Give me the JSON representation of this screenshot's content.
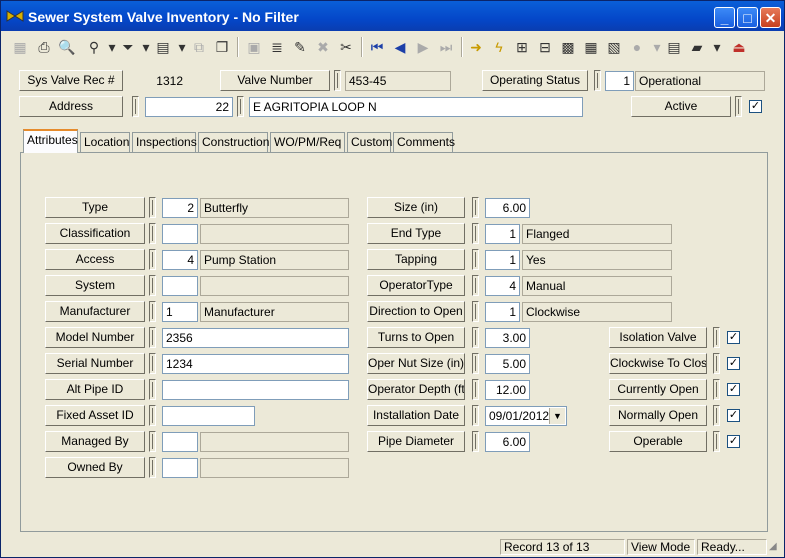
{
  "window": {
    "title": "Sewer System Valve Inventory - No Filter"
  },
  "header": {
    "rec_label": "Sys Valve Rec #",
    "rec_value": "1312",
    "valve_number_label": "Valve Number",
    "valve_number": "453-45",
    "operating_status_label": "Operating Status",
    "operating_status_code": "1",
    "operating_status": "Operational",
    "address_label": "Address",
    "address_number": "22",
    "address_street": "E AGRITOPIA LOOP N",
    "active_label": "Active",
    "active_checked": "✓"
  },
  "tabs": [
    "Attributes",
    "Location",
    "Inspections",
    "Construction",
    "WO/PM/Req",
    "Custom",
    "Comments"
  ],
  "left": {
    "type": {
      "label": "Type",
      "code": "2",
      "value": "Butterfly"
    },
    "classification": {
      "label": "Classification",
      "code": "",
      "value": ""
    },
    "access": {
      "label": "Access",
      "code": "4",
      "value": "Pump Station"
    },
    "system": {
      "label": "System",
      "code": "",
      "value": ""
    },
    "manufacturer": {
      "label": "Manufacturer",
      "code": "1",
      "value": "Manufacturer"
    },
    "model_number": {
      "label": "Model Number",
      "value": "2356"
    },
    "serial_number": {
      "label": "Serial Number",
      "value": "1234"
    },
    "alt_pipe_id": {
      "label": "Alt Pipe ID",
      "value": ""
    },
    "fixed_asset_id": {
      "label": "Fixed Asset ID",
      "value": ""
    },
    "managed_by": {
      "label": "Managed By",
      "code": "",
      "value": ""
    },
    "owned_by": {
      "label": "Owned By",
      "code": "",
      "value": ""
    }
  },
  "middle": {
    "size": {
      "label": "Size (in)",
      "value": "6.00"
    },
    "end_type": {
      "label": "End Type",
      "code": "1",
      "value": "Flanged"
    },
    "tapping": {
      "label": "Tapping",
      "code": "1",
      "value": "Yes"
    },
    "operator_type": {
      "label": "OperatorType",
      "code": "4",
      "value": "Manual"
    },
    "direction_to_open": {
      "label": "Direction to Open",
      "code": "1",
      "value": "Clockwise"
    },
    "turns_to_open": {
      "label": "Turns to Open",
      "value": "3.00"
    },
    "oper_nut_size": {
      "label": "Oper Nut Size (in)",
      "value": "5.00"
    },
    "operator_depth": {
      "label": "Operator Depth (ft)",
      "value": "12.00"
    },
    "installation_date": {
      "label": "Installation Date",
      "value": "09/01/2012"
    },
    "pipe_diameter": {
      "label": "Pipe Diameter",
      "value": "6.00"
    }
  },
  "right": {
    "isolation_valve": {
      "label": "Isolation Valve",
      "checked": "✓"
    },
    "clockwise_to_close": {
      "label": "Clockwise To Close",
      "checked": "✓"
    },
    "currently_open": {
      "label": "Currently Open",
      "checked": "✓"
    },
    "normally_open": {
      "label": "Normally Open",
      "checked": "✓"
    },
    "operable": {
      "label": "Operable",
      "checked": "✓"
    }
  },
  "status": {
    "record": "Record 13 of 13",
    "mode": "View Mode",
    "state": "Ready..."
  }
}
